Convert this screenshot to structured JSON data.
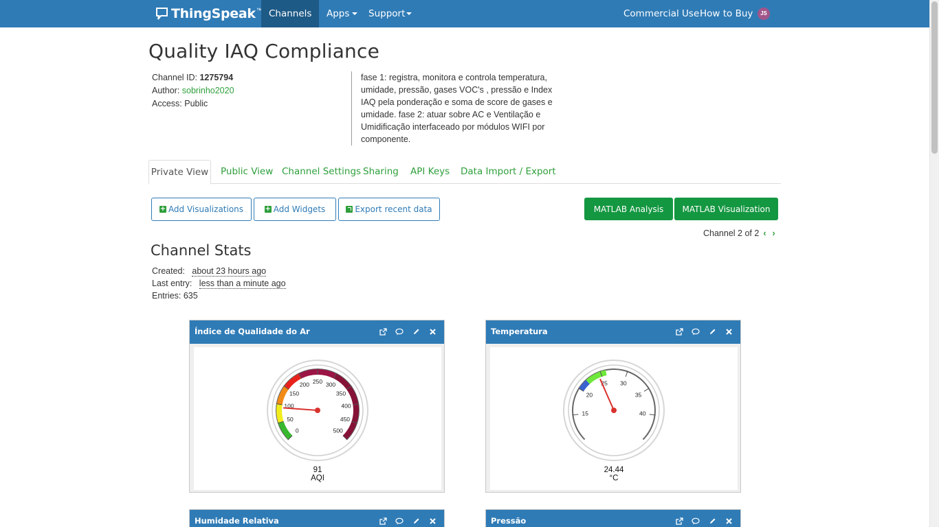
{
  "nav": {
    "brand": "ThingSpeak",
    "brand_tm": "™",
    "channels": "Channels",
    "apps": "Apps",
    "support": "Support",
    "commercial": "Commercial Use",
    "how_to_buy": "How to Buy",
    "avatar": "JS"
  },
  "channel": {
    "title": "Quality IAQ Compliance",
    "id_label": "Channel ID: ",
    "id_value": "1275794",
    "author_label": "Author: ",
    "author_value": "sobrinho2020",
    "access": "Access: Public",
    "description": "fase 1: registra, monitora e controla temperatura, umidade, pressão, gases VOC's , pressão e Index IAQ pela ponderação e soma de score de gases e umidade. fase 2: atuar sobre AC e Ventilação e Umidificação interfaceado por módulos WIFI por componente."
  },
  "tabs": [
    "Private View",
    "Public View",
    "Channel Settings",
    "Sharing",
    "API Keys",
    "Data Import / Export"
  ],
  "buttons": {
    "add_vis": "Add Visualizations",
    "add_widgets": "Add Widgets",
    "export": "Export recent data",
    "matlab_analysis": "MATLAB Analysis",
    "matlab_vis": "MATLAB Visualization"
  },
  "pager": "Channel 2 of 2",
  "stats": {
    "title": "Channel Stats",
    "created_label": "Created:",
    "created_value": "about 23 hours ago",
    "last_label": "Last entry:",
    "last_value": "less than a minute ago",
    "entries": "Entries: 635"
  },
  "widgets": [
    {
      "title": "Índice de Qualidade do Ar",
      "value": "91",
      "unit": "AQI",
      "min": 0,
      "max": 500,
      "ticks": [
        0,
        50,
        100,
        150,
        200,
        250,
        300,
        350,
        400,
        450,
        500
      ],
      "reading": 91,
      "bands": [
        {
          "from": 0,
          "to": 50,
          "color": "#38b82e"
        },
        {
          "from": 50,
          "to": 100,
          "color": "#f1ec1b"
        },
        {
          "from": 100,
          "to": 150,
          "color": "#f28b16"
        },
        {
          "from": 150,
          "to": 200,
          "color": "#e8221b"
        },
        {
          "from": 200,
          "to": 300,
          "color": "#9c1445"
        },
        {
          "from": 300,
          "to": 500,
          "color": "#861337"
        }
      ]
    },
    {
      "title": "Temperatura",
      "value": "24.44",
      "unit": "°C",
      "min": 10,
      "max": 45,
      "ticks": [
        15,
        20,
        25,
        30,
        35,
        40
      ],
      "reading": 24.44,
      "bands": [
        {
          "from": 20,
          "to": 22,
          "color": "#3a63d0"
        },
        {
          "from": 22,
          "to": 26,
          "color": "#6ee83a"
        }
      ]
    },
    {
      "title": "Humidade Relativa"
    },
    {
      "title": "Pressão"
    }
  ]
}
